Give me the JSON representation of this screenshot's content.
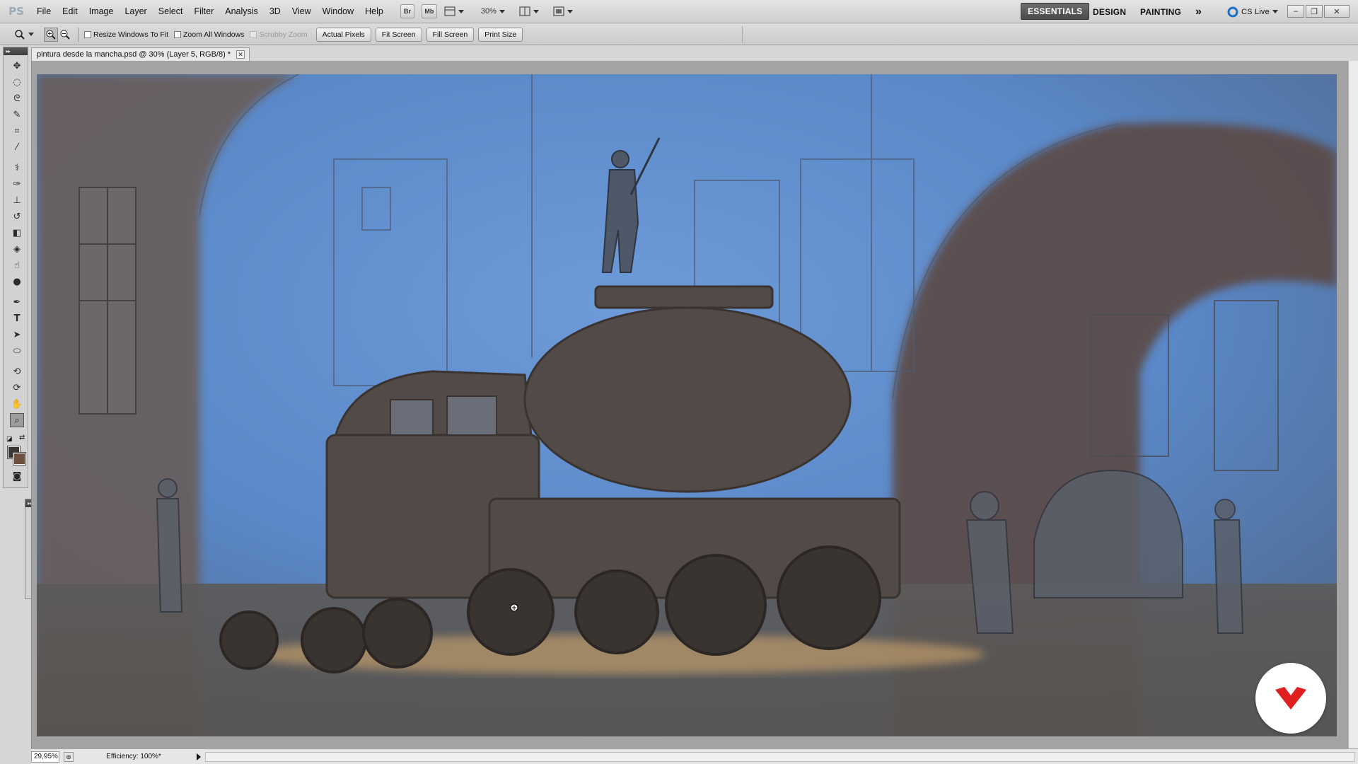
{
  "app": {
    "logo": "PS"
  },
  "menu": [
    "File",
    "Edit",
    "Image",
    "Layer",
    "Select",
    "Filter",
    "Analysis",
    "3D",
    "View",
    "Window",
    "Help"
  ],
  "menubar_buttons": {
    "bridge": "Br",
    "minibridge": "Mb",
    "zoom_level": "30%"
  },
  "workspaces": {
    "essentials": "ESSENTIALS",
    "design": "DESIGN",
    "painting": "PAINTING",
    "more": "»",
    "cslive": "CS Live"
  },
  "window_controls": {
    "minimize": "–",
    "restore": "❐",
    "close": "✕"
  },
  "options": {
    "resize_windows": "Resize Windows To Fit",
    "zoom_all": "Zoom All Windows",
    "scrubby": "Scrubby Zoom",
    "actual_pixels": "Actual Pixels",
    "fit_screen": "Fit Screen",
    "fill_screen": "Fill Screen",
    "print_size": "Print Size"
  },
  "document": {
    "tab_title": "pintura desde la mancha.psd @ 30% (Layer 5, RGB/8) *"
  },
  "status": {
    "zoom": "29,95%",
    "efficiency": "Efficiency: 100%*"
  },
  "toolbox": {
    "tools": [
      "move-icon",
      "marquee-icon",
      "lasso-icon",
      "quick-select-icon",
      "crop-icon",
      "eyedropper-icon",
      "healing-icon",
      "brush-icon",
      "clone-stamp-icon",
      "history-brush-icon",
      "eraser-icon",
      "paint-bucket-icon",
      "smudge-icon",
      "dodge-icon",
      "pen-icon",
      "type-icon",
      "path-select-icon",
      "ellipse-icon",
      "3d-rotate-icon",
      "3d-orbit-icon",
      "hand-icon",
      "zoom-icon"
    ],
    "active_tool": "zoom-icon",
    "foreground_color": "#3a3633",
    "background_color": "#6e5040"
  },
  "colors": {
    "sky": "#5f8fd0",
    "ground": "#56514d",
    "brand": "#e02020"
  }
}
